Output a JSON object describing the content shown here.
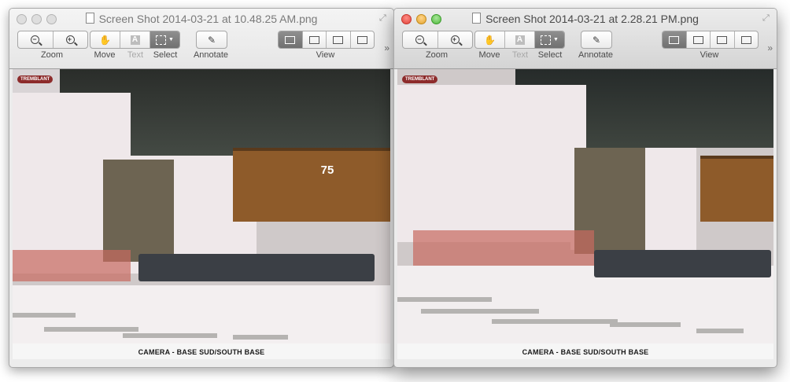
{
  "windows": [
    {
      "title": "Screen Shot 2014-03-21 at 10.48.25 AM.png",
      "active": false,
      "toolbar": {
        "zoom_label": "Zoom",
        "move_label": "Move",
        "text_label": "Text",
        "select_label": "Select",
        "annotate_label": "Annotate",
        "view_label": "View",
        "text_icon_glyph": "A",
        "zoom_out_glyph": "−",
        "zoom_in_glyph": "+"
      },
      "image": {
        "caption": "CAMERA - BASE SUD/SOUTH BASE",
        "logo": "TREMBLANT",
        "sign": "75"
      }
    },
    {
      "title": "Screen Shot 2014-03-21 at 2.28.21 PM.png",
      "active": true,
      "toolbar": {
        "zoom_label": "Zoom",
        "move_label": "Move",
        "text_label": "Text",
        "select_label": "Select",
        "annotate_label": "Annotate",
        "view_label": "View",
        "text_icon_glyph": "A",
        "zoom_out_glyph": "−",
        "zoom_in_glyph": "+"
      },
      "image": {
        "caption": "CAMERA - BASE SUD/SOUTH BASE",
        "logo": "TREMBLANT"
      }
    }
  ],
  "icons": {
    "move": "hand-icon",
    "annotate": "pen-icon",
    "overflow": "chevron-double-right-icon",
    "fullscreen": "fullscreen-arrows-icon"
  },
  "colors": {
    "close": "#e0443b",
    "minimize": "#e3a52e",
    "zoom": "#4fb83d",
    "selected_segment": "#7a7a7a"
  }
}
